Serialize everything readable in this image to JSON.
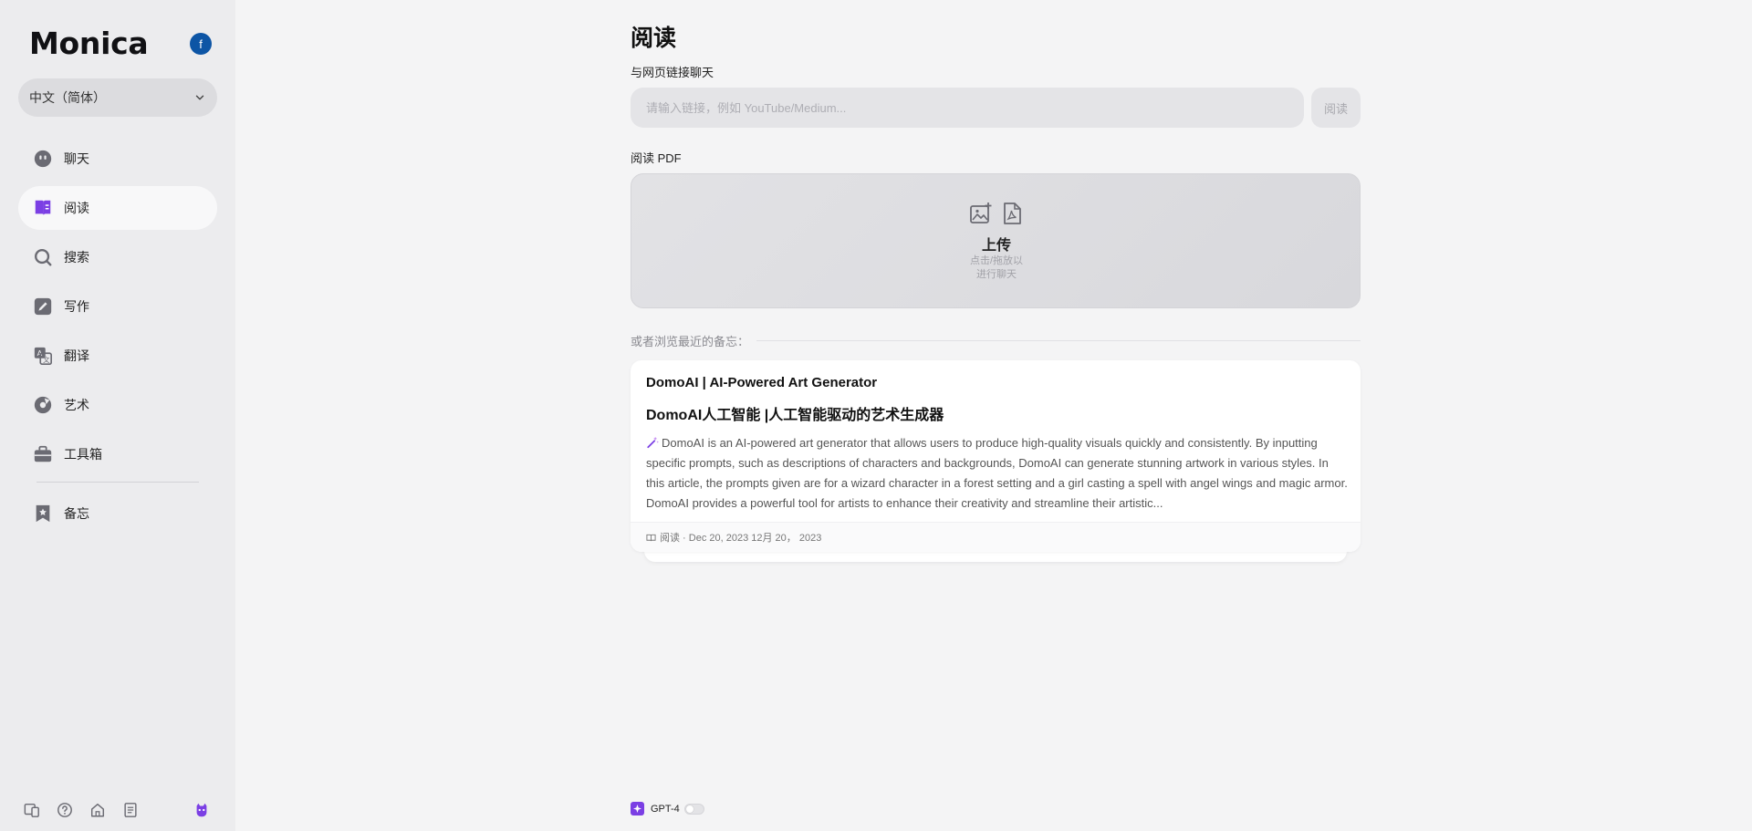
{
  "sidebar": {
    "brand": "Monica",
    "avatar_initial": "f",
    "language": "中文（简体）",
    "items": [
      {
        "label": "聊天",
        "icon": "chat-robot-icon"
      },
      {
        "label": "阅读",
        "icon": "book-icon",
        "active": true
      },
      {
        "label": "搜索",
        "icon": "search-icon"
      },
      {
        "label": "写作",
        "icon": "pen-icon"
      },
      {
        "label": "翻译",
        "icon": "translate-icon"
      },
      {
        "label": "艺术",
        "icon": "palette-icon"
      },
      {
        "label": "工具箱",
        "icon": "toolbox-icon"
      }
    ],
    "memo": {
      "label": "备忘",
      "icon": "bookmark-star-icon"
    },
    "bottom_icons": [
      "devices-icon",
      "help-icon",
      "home-icon",
      "notes-icon",
      "monica-logo-icon"
    ]
  },
  "main": {
    "title": "阅读",
    "chat_link_label": "与网页链接聊天",
    "url_placeholder": "请输入链接，例如 YouTube/Medium...",
    "read_button": "阅读",
    "pdf_label": "阅读 PDF",
    "upload_title": "上传",
    "upload_sub_line1": "点击/拖放以",
    "upload_sub_line2": "进行聊天",
    "recent_label": "或者浏览最近的备忘：",
    "memo_card": {
      "site": "DomoAI | AI-Powered Art Generator",
      "title": "DomoAI人工智能 |人工智能驱动的艺术生成器",
      "description": "DomoAI is an AI-powered art generator that allows users to produce high-quality visuals quickly and consistently. By inputting specific prompts, such as descriptions of characters and backgrounds, DomoAI can generate stunning artwork in various styles. In this article, the prompts given are for a wizard character in a forest setting and a girl casting a spell with angel wings and magic armor. DomoAI provides a powerful tool for artists to enhance their creativity and streamline their artistic...",
      "footer": "阅读 · Dec 20, 2023 12月 20， 2023"
    },
    "model": "GPT-4"
  },
  "colors": {
    "accent": "#7b3fe4",
    "icon_gray": "#6b6b73",
    "avatar": "#0d55a5"
  }
}
